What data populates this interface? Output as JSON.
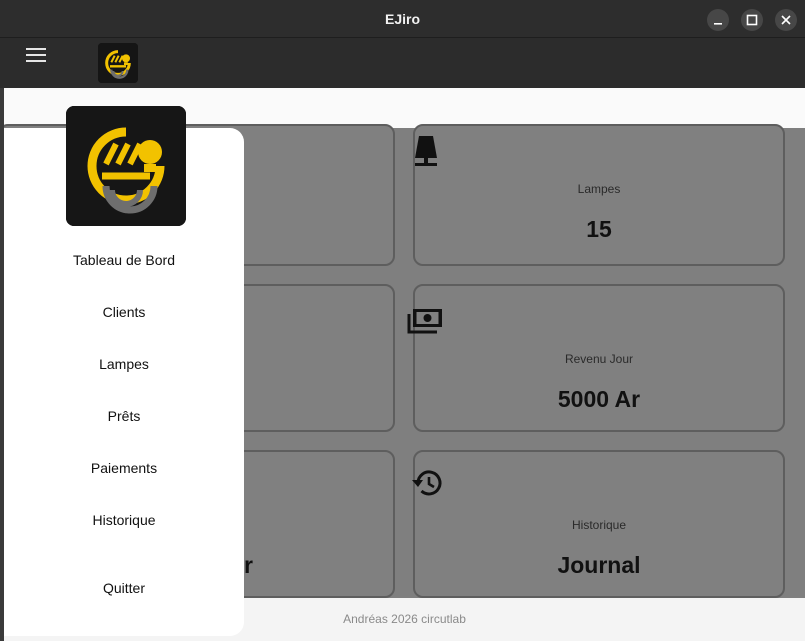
{
  "window": {
    "title": "EJiro"
  },
  "drawer": {
    "items": [
      {
        "label": "Tableau de Bord",
        "icon": "dashboard"
      },
      {
        "label": "Clients",
        "icon": "clients"
      },
      {
        "label": "Lampes",
        "icon": "lamp"
      },
      {
        "label": "Prêts",
        "icon": "loans"
      },
      {
        "label": "Paiements",
        "icon": "payments"
      },
      {
        "label": "Historique",
        "icon": "history"
      }
    ],
    "quit_label": "Quitter"
  },
  "dashboard": {
    "cards": [
      {
        "label": "Lampes",
        "value": "15",
        "icon": "lamp-icon"
      },
      {
        "label": "Revenu Jour",
        "value": "5000 Ar",
        "icon": "money-icon"
      },
      {
        "label": "Historique",
        "value": "Journal",
        "icon": "history-icon"
      }
    ],
    "partial_value": "r"
  },
  "footer": {
    "text": "Andréas 2026 circutlab"
  },
  "colors": {
    "accent": "#f2c200",
    "overlay": "#7f7f7f",
    "drawer": "#ffffff",
    "titlebar": "#2d2d2d"
  }
}
